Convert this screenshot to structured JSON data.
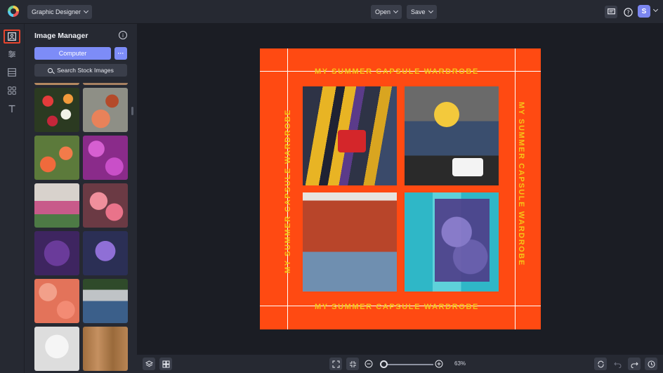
{
  "app": {
    "project_dropdown": "Graphic Designer"
  },
  "toolbar": {
    "open_label": "Open",
    "save_label": "Save",
    "user_initial": "S"
  },
  "panel": {
    "title": "Image Manager",
    "computer_button": "Computer",
    "more_button": "···",
    "search_button": "Search Stock Images"
  },
  "canvas": {
    "caption_top": "MY SUMMER CAPSULE WARDROBE",
    "caption_bottom": "MY SUMMER CAPSULE WARDROBE",
    "caption_left": "MY SUMMER CAPSULE WARDROBE",
    "caption_right": "MY SUMMER CAPSULE WARDROBE",
    "background": "#ff4a12",
    "caption_color": "#f5c518"
  },
  "bottom": {
    "zoom": "63%"
  },
  "icons": {
    "rail": [
      "image-manager-icon",
      "adjustments-icon",
      "layout-icon",
      "graphics-icon",
      "text-icon"
    ],
    "top_right": [
      "comment-icon",
      "help-icon"
    ],
    "bottom_right": [
      "refresh-icon",
      "undo-icon",
      "redo-icon",
      "history-icon"
    ]
  }
}
